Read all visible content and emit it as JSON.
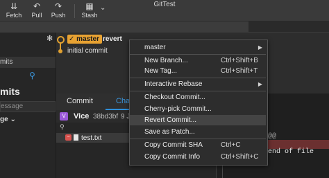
{
  "toolbar": {
    "fetch": "Fetch",
    "pull": "Pull",
    "push": "Push",
    "stash": "Stash",
    "stash_dropdown": "⌄"
  },
  "window": {
    "title": "GitTest"
  },
  "sidebar": {
    "remotes_header": "mits",
    "commits_header": "mits",
    "message_placeholder": "essage",
    "staged_label": "ge"
  },
  "graph": {
    "branch_current": "master",
    "branch_other": "revert",
    "commit_message": "initial commit"
  },
  "lower": {
    "tab_commit": "Commit",
    "tab_changes": "Cha",
    "author": "Vice",
    "author_initial": "V",
    "hash": "38bd3bf",
    "date": "9 J",
    "file_name": "test.txt"
  },
  "diff": {
    "hunk_marker": "@@",
    "line_text": "end of file"
  },
  "context_menu": {
    "items": [
      {
        "label": "master",
        "shortcut": "",
        "submenu": true
      },
      {
        "label": "New Branch...",
        "shortcut": "Ctrl+Shift+B"
      },
      {
        "label": "New Tag...",
        "shortcut": "Ctrl+Shift+T"
      },
      {
        "label": "Interactive Rebase",
        "shortcut": "",
        "submenu": true
      },
      {
        "label": "Checkout Commit...",
        "shortcut": ""
      },
      {
        "label": "Cherry-pick Commit...",
        "shortcut": ""
      },
      {
        "label": "Revert Commit...",
        "shortcut": "",
        "highlighted": true
      },
      {
        "label": "Save as Patch...",
        "shortcut": ""
      },
      {
        "label": "Copy Commit SHA",
        "shortcut": "Ctrl+C"
      },
      {
        "label": "Copy Commit Info",
        "shortcut": "Ctrl+Shift+C"
      }
    ]
  },
  "colors": {
    "branch_accent": "#e8a232",
    "tab_accent": "#2f8fd9",
    "removed_line": "#6b3030"
  }
}
